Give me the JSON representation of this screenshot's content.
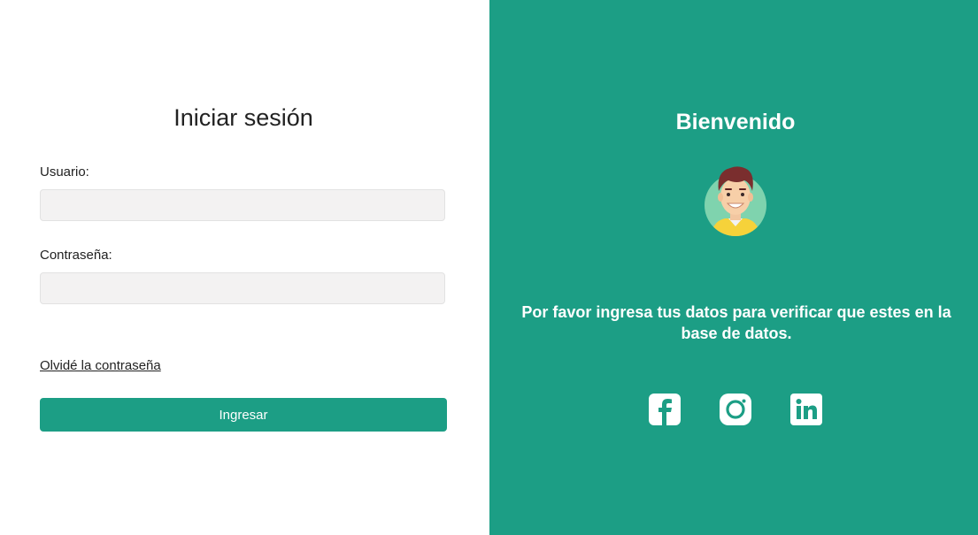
{
  "login": {
    "title": "Iniciar sesión",
    "username_label": "Usuario:",
    "username_value": "",
    "password_label": "Contraseña:",
    "password_value": "",
    "forgot_link": "Olvidé la contraseña",
    "submit_label": "Ingresar"
  },
  "welcome": {
    "title": "Bienvenido",
    "message": "Por favor ingresa tus datos para verificar que estes en la base de datos.",
    "avatar_icon": "user-avatar-icon"
  },
  "social": [
    {
      "name": "facebook-icon"
    },
    {
      "name": "instagram-icon"
    },
    {
      "name": "linkedin-icon"
    }
  ],
  "colors": {
    "accent": "#1c9e85",
    "input_bg": "#f3f2f2",
    "text": "#222222"
  }
}
